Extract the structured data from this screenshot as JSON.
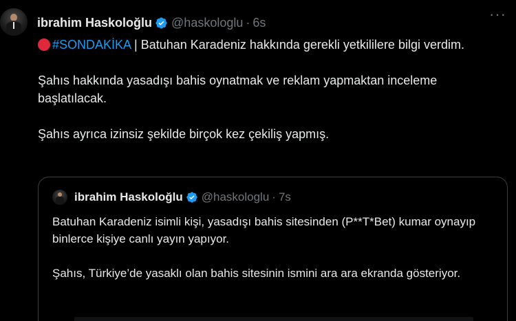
{
  "tweet": {
    "author_name": "ibrahim Haskoloğlu",
    "handle": "@haskologlu",
    "separator": "·",
    "time": "6s",
    "more_icon": "more-horizontal-icon",
    "hashtag": "#SONDAKİKA",
    "line1_rest": " | Batuhan Karadeniz hakkında gerekli yetkililere bilgi verdim.",
    "paragraph2": "Şahıs hakkında yasadışı bahis oynatmak ve reklam yapmaktan inceleme başlatılacak.",
    "paragraph3": "Şahıs ayrıca izinsiz şekilde birçok kez çekiliş yapmış."
  },
  "quote": {
    "author_name": "ibrahim Haskoloğlu",
    "handle": "@haskologlu",
    "separator": "·",
    "time": "7s",
    "paragraph1": "Batuhan Karadeniz isimli kişi, yasadışı bahis sitesinden (P**T*Bet) kumar oynayıp binlerce kişiye canlı yayın yapıyor.",
    "paragraph2": "Şahıs, Türkiye’de yasaklı olan bahis sitesinin ismini ara ara ekranda gösteriyor."
  },
  "colors": {
    "background": "#000000",
    "text": "#e7e9ea",
    "muted": "#71767b",
    "link": "#1d9bf0",
    "verified": "#1d9bf0",
    "alert_red": "#e0283c",
    "border": "#3a3f44"
  }
}
